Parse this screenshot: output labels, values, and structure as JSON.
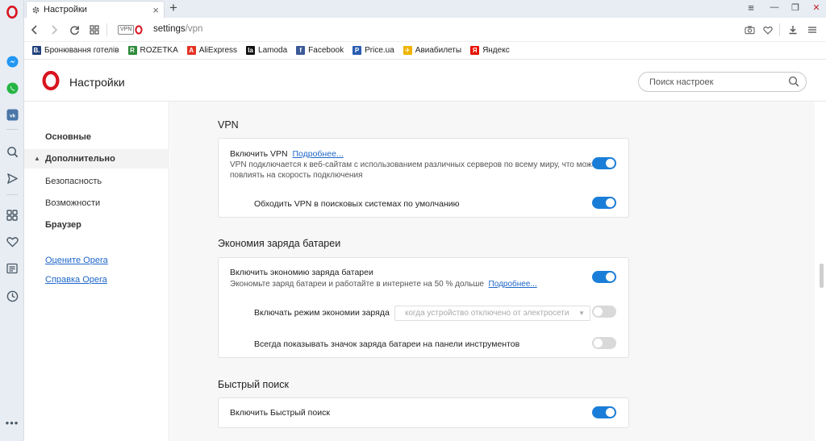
{
  "tab": {
    "title": "Настройки",
    "close": "×"
  },
  "newtab": "+",
  "window": {
    "menu": "≡",
    "minimize": "—",
    "restore": "❐",
    "close": "✕"
  },
  "address": {
    "vpn_badge": "VPN",
    "url_main": "settings",
    "url_rest": "/vpn"
  },
  "bookmarks": [
    {
      "label": "Бронювання готелів",
      "icon": "booking-icon",
      "color": "#1f3f7a",
      "glyph": "B."
    },
    {
      "label": "ROZETKA",
      "icon": "rozetka-icon",
      "color": "#2e8b3a",
      "glyph": "R"
    },
    {
      "label": "AliExpress",
      "icon": "aliexpress-icon",
      "color": "#e43225",
      "glyph": "A"
    },
    {
      "label": "Lamoda",
      "icon": "lamoda-icon",
      "color": "#111111",
      "glyph": "la"
    },
    {
      "label": "Facebook",
      "icon": "facebook-icon",
      "color": "#3b5998",
      "glyph": "f"
    },
    {
      "label": "Price.ua",
      "icon": "price-icon",
      "color": "#2a5db0",
      "glyph": "P"
    },
    {
      "label": "Авиабилеты",
      "icon": "plane-icon",
      "color": "#f0b400",
      "glyph": "✈"
    },
    {
      "label": "Яндекс",
      "icon": "yandex-icon",
      "color": "#e61400",
      "glyph": "Я"
    }
  ],
  "header": {
    "title": "Настройки",
    "search_placeholder": "Поиск настроек"
  },
  "nav": {
    "basic": "Основные",
    "advanced": "Дополнительно",
    "security": "Безопасность",
    "features": "Возможности",
    "browser": "Браузер",
    "rate": "Оцените Opera",
    "help": "Справка Opera"
  },
  "vpn": {
    "title": "VPN",
    "enable_label": "Включить VPN",
    "more": "Подробнее...",
    "desc_line1": "VPN подключается к веб-сайтам с использованием различных серверов по всему миру, что может",
    "desc_line2": "повлиять на скорость подключения",
    "bypass_label": "Обходить VPN в поисковых системах по умолчанию",
    "enable_on": true,
    "bypass_on": true
  },
  "battery": {
    "title": "Экономия заряда батареи",
    "enable_label": "Включить экономию заряда батареи",
    "desc": "Экономьте заряд батареи и работайте в интернете на 50 % дольше",
    "more": "Подробнее...",
    "mode_label": "Включать режим экономии заряда",
    "mode_value": "когда устройство отключено от электросети",
    "icon_label": "Всегда показывать значок заряда батареи на панели инструментов",
    "enable_on": true,
    "mode_on": false,
    "icon_on": false
  },
  "quick": {
    "title": "Быстрый поиск",
    "enable_label": "Включить Быстрый поиск",
    "enable_on": true
  },
  "colors": {
    "accent": "#1a7ed8",
    "opera_red": "#d8141e",
    "link": "#1e66c8"
  }
}
